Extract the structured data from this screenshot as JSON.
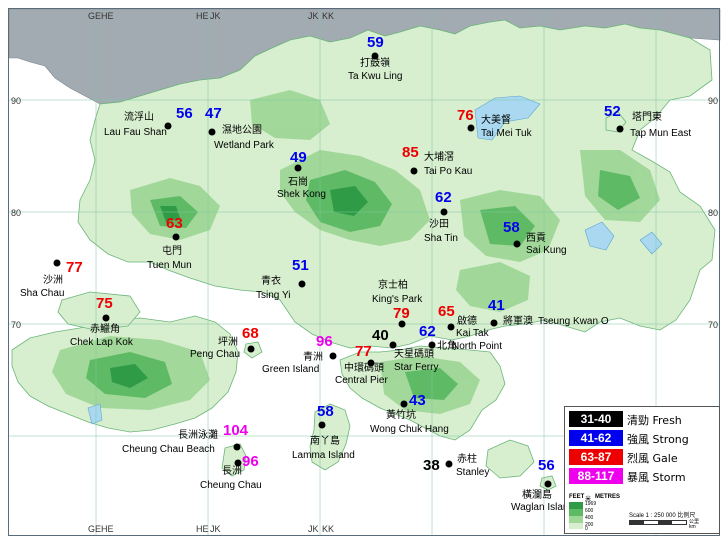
{
  "map_title": "",
  "grid_labels": {
    "top": [
      "GE",
      "HE",
      "HE",
      "JK",
      "JK",
      "KK"
    ],
    "bottom": [
      "GE",
      "HE",
      "HE",
      "JK",
      "JK",
      "KK"
    ],
    "right": [
      "90",
      "80",
      "70",
      "60"
    ],
    "left": [
      "90",
      "80",
      "70"
    ]
  },
  "stations": [
    {
      "id": "ta-kwu-ling",
      "cn": "打鼓嶺",
      "en": "Ta Kwu Ling",
      "value": "59",
      "color": "#0000ee"
    },
    {
      "id": "lau-fau-shan",
      "cn": "流浮山",
      "en": "Lau Fau Shan",
      "value": "56",
      "color": "#0000ee"
    },
    {
      "id": "wetland-park",
      "cn": "濕地公園",
      "en": "Wetland Park",
      "value": "47",
      "color": "#0000ee"
    },
    {
      "id": "tai-mei-tuk",
      "cn": "大美督",
      "en": "Tai Mei Tuk",
      "value": "76",
      "color": "#ee0000"
    },
    {
      "id": "tap-mun-east",
      "cn": "塔門東",
      "en": "Tap Mun East",
      "value": "52",
      "color": "#0000ee"
    },
    {
      "id": "tai-po-kau",
      "cn": "大埔滘",
      "en": "Tai Po Kau",
      "value": "85",
      "color": "#ee0000"
    },
    {
      "id": "shek-kong",
      "cn": "石崗",
      "en": "Shek Kong",
      "value": "49",
      "color": "#0000ee"
    },
    {
      "id": "sha-tin",
      "cn": "沙田",
      "en": "Sha Tin",
      "value": "62",
      "color": "#0000ee"
    },
    {
      "id": "sai-kung",
      "cn": "西貢",
      "en": "Sai Kung",
      "value": "58",
      "color": "#0000ee"
    },
    {
      "id": "tuen-mun",
      "cn": "屯門",
      "en": "Tuen Mun",
      "value": "63",
      "color": "#ee0000"
    },
    {
      "id": "sha-chau",
      "cn": "沙洲",
      "en": "Sha Chau",
      "value": "77",
      "color": "#ee0000"
    },
    {
      "id": "tsing-yi",
      "cn": "青衣",
      "en": "Tsing Yi",
      "value": "51",
      "color": "#0000ee"
    },
    {
      "id": "kings-park",
      "cn": "京士柏",
      "en": "King's Park",
      "value": "79",
      "color": "#ee0000"
    },
    {
      "id": "kai-tak",
      "cn": "啟德",
      "en": "Kai Tak",
      "value": "65",
      "color": "#ee0000"
    },
    {
      "id": "tseung-kwan-o",
      "cn": "將軍澳",
      "en": "Tseung Kwan O",
      "value": "41",
      "color": "#0000ee"
    },
    {
      "id": "chek-lap-kok",
      "cn": "赤鱲角",
      "en": "Chek Lap Kok",
      "value": "75",
      "color": "#ee0000"
    },
    {
      "id": "peng-chau",
      "cn": "坪洲",
      "en": "Peng Chau",
      "value": "68",
      "color": "#ee0000"
    },
    {
      "id": "green-island",
      "cn": "青洲",
      "en": "Green Island",
      "value": "96",
      "color": "#ee00ee"
    },
    {
      "id": "star-ferry",
      "cn": "天星碼頭",
      "en": "Star Ferry",
      "value": "40",
      "color": "#000000"
    },
    {
      "id": "north-point",
      "cn": "北角",
      "en": "North Point",
      "value": "62",
      "color": "#0000ee"
    },
    {
      "id": "central-pier",
      "cn": "中環碼頭",
      "en": "Central Pier",
      "value": "77",
      "color": "#ee0000"
    },
    {
      "id": "wong-chuk-hang",
      "cn": "黃竹坑",
      "en": "Wong Chuk Hang",
      "value": "43",
      "color": "#0000ee"
    },
    {
      "id": "lamma-island",
      "cn": "南丫島",
      "en": "Lamma Island",
      "value": "58",
      "color": "#0000ee"
    },
    {
      "id": "cheung-chau-beach",
      "cn": "長洲泳灘",
      "en": "Cheung Chau Beach",
      "value": "104",
      "color": "#ee00ee"
    },
    {
      "id": "cheung-chau",
      "cn": "長洲",
      "en": "Cheung Chau",
      "value": "96",
      "color": "#ee00ee"
    },
    {
      "id": "stanley",
      "cn": "赤柱",
      "en": "Stanley",
      "value": "38",
      "color": "#000000"
    },
    {
      "id": "waglan-island",
      "cn": "橫瀾島",
      "en": "Waglan Island",
      "value": "56",
      "color": "#0000ee"
    }
  ],
  "legend": {
    "items": [
      {
        "range": "31-40",
        "cn": "清勁",
        "en": "Fresh",
        "color": "#000000"
      },
      {
        "range": "41-62",
        "cn": "強風",
        "en": "Strong",
        "color": "#0000ee"
      },
      {
        "range": "63-87",
        "cn": "烈風",
        "en": "Gale",
        "color": "#ee0000"
      },
      {
        "range": "88-117",
        "cn": "暴風",
        "en": "Storm",
        "color": "#ee00ee"
      }
    ],
    "elev_unit_cn": "米",
    "elev_unit_en": "METRES",
    "elev_levels": [
      "1969",
      "600",
      "400",
      "200",
      "0"
    ],
    "feet_label": "FEET",
    "feet_levels": [
      "1968",
      "1312",
      "656",
      "0"
    ],
    "scale_text": "Scale 1 : 250 000",
    "scale_cn": "比例尺",
    "km_label": "公里",
    "km_label_en": "km"
  },
  "colors": {
    "sea": "#ffffff",
    "mainland": "#a3abb2",
    "land_low": "#d7efcf",
    "land_mid": "#9fd797",
    "land_high": "#5fba66",
    "land_peak": "#2f9b47",
    "water": "#a9d8f0",
    "grid": "#7fc6a0"
  }
}
